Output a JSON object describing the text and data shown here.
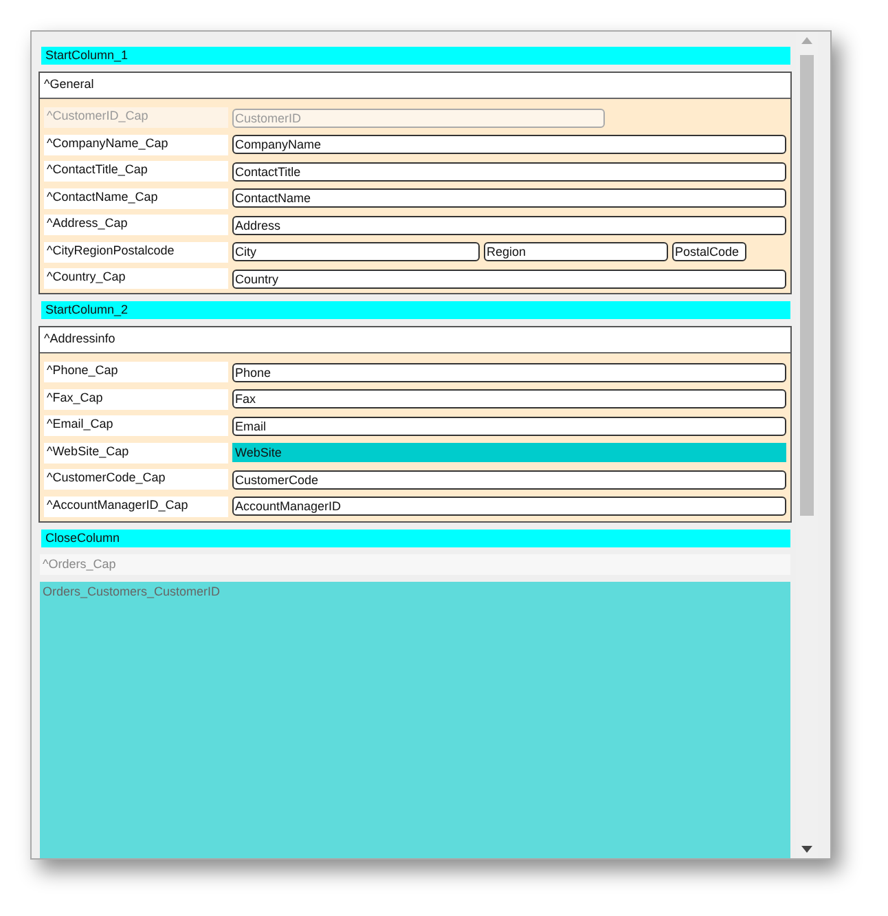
{
  "columns": [
    {
      "title": "StartColumn_1",
      "group": {
        "title": "^General",
        "rows": [
          {
            "label": "^CustomerID_Cap",
            "disabled": true,
            "fields": [
              {
                "value": "CustomerID",
                "highlighted": false
              }
            ]
          },
          {
            "label": "^CompanyName_Cap",
            "disabled": false,
            "fields": [
              {
                "value": "CompanyName",
                "highlighted": false
              }
            ]
          },
          {
            "label": "^ContactTitle_Cap",
            "disabled": false,
            "fields": [
              {
                "value": "ContactTitle",
                "highlighted": false
              }
            ]
          },
          {
            "label": "^ContactName_Cap",
            "disabled": false,
            "fields": [
              {
                "value": "ContactName",
                "highlighted": false
              }
            ]
          },
          {
            "label": "^Address_Cap",
            "disabled": false,
            "fields": [
              {
                "value": "Address",
                "highlighted": false
              }
            ]
          },
          {
            "label": "^CityRegionPostalcode",
            "disabled": false,
            "fields": [
              {
                "value": "City",
                "highlighted": false
              },
              {
                "value": "Region",
                "highlighted": false
              },
              {
                "value": "PostalCode",
                "highlighted": false
              }
            ]
          },
          {
            "label": "^Country_Cap",
            "disabled": false,
            "fields": [
              {
                "value": "Country",
                "highlighted": false
              }
            ]
          }
        ]
      }
    },
    {
      "title": "StartColumn_2",
      "group": {
        "title": "^Addressinfo",
        "rows": [
          {
            "label": "^Phone_Cap",
            "disabled": false,
            "fields": [
              {
                "value": "Phone",
                "highlighted": false
              }
            ]
          },
          {
            "label": "^Fax_Cap",
            "disabled": false,
            "fields": [
              {
                "value": "Fax",
                "highlighted": false
              }
            ]
          },
          {
            "label": "^Email_Cap",
            "disabled": false,
            "fields": [
              {
                "value": "Email",
                "highlighted": false
              }
            ]
          },
          {
            "label": "^WebSite_Cap",
            "disabled": false,
            "fields": [
              {
                "value": "WebSite",
                "highlighted": true
              }
            ]
          },
          {
            "label": "^CustomerCode_Cap",
            "disabled": false,
            "fields": [
              {
                "value": "CustomerCode",
                "highlighted": false
              }
            ]
          },
          {
            "label": "^AccountManagerID_Cap",
            "disabled": false,
            "fields": [
              {
                "value": "AccountManagerID",
                "highlighted": false
              }
            ]
          }
        ]
      }
    }
  ],
  "close_column": "CloseColumn",
  "orders": {
    "caption": "^Orders_Cap",
    "grid_title": "Orders_Customers_CustomerID"
  }
}
